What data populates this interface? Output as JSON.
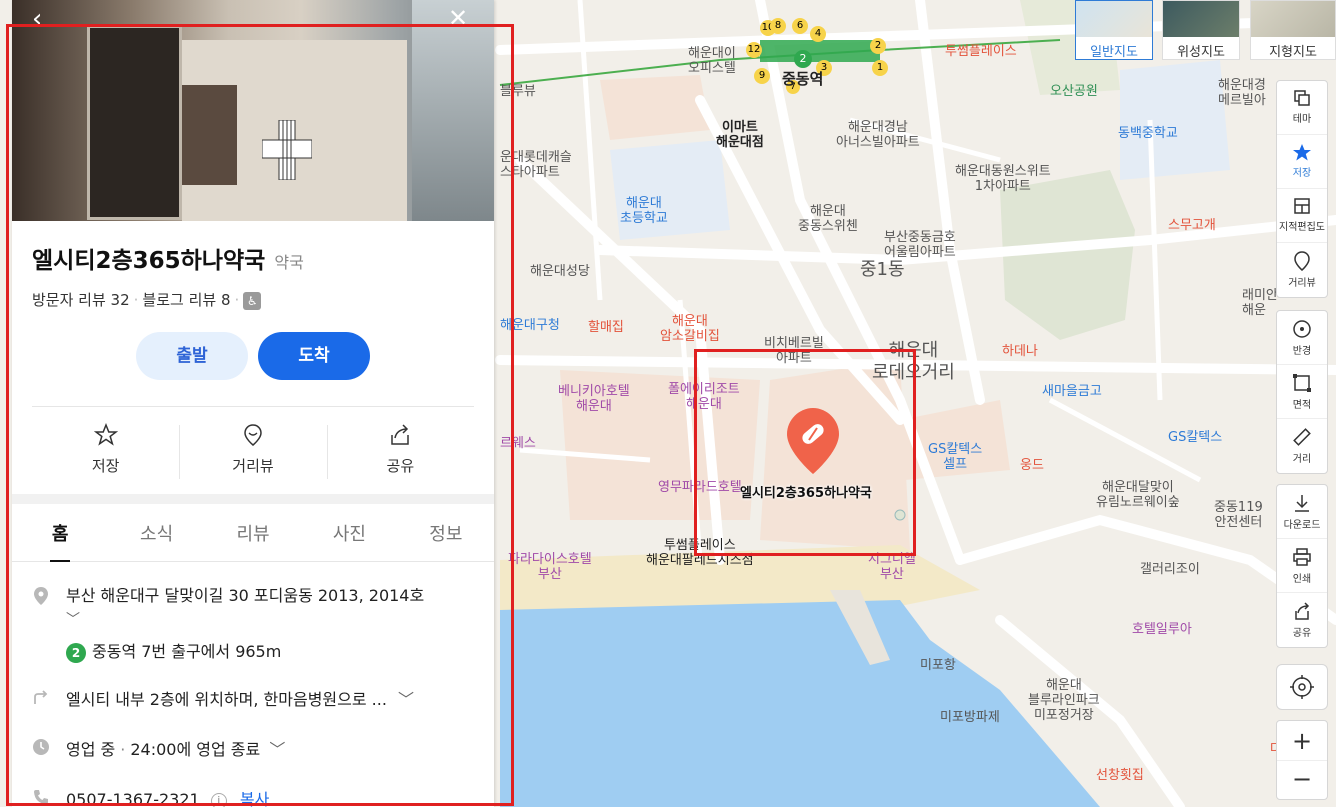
{
  "panel": {
    "title": "엘시티2층365하나약국",
    "category": "약국",
    "visitor_reviews": "방문자 리뷰 32",
    "blog_reviews": "블로그 리뷰 8",
    "buttons": {
      "depart": "출발",
      "arrive": "도착"
    },
    "actions": [
      {
        "label": "저장",
        "icon": "star-icon"
      },
      {
        "label": "거리뷰",
        "icon": "street-view-icon"
      },
      {
        "label": "공유",
        "icon": "share-icon"
      }
    ],
    "tabs": [
      "홈",
      "소식",
      "리뷰",
      "사진",
      "정보"
    ],
    "active_tab": "홈",
    "address": "부산 해운대구 달맞이길 30 포디움동 2013, 2014호",
    "subway_line": "2",
    "subway_text": "중동역 7번 출구에서 965m",
    "directions": "엘시티 내부 2층에 위치하며, 한마음병원으로 ...",
    "hours_status": "영업 중",
    "hours_text": "24:00에 영업 종료",
    "phone": "0507-1367-2321",
    "copy": "복사"
  },
  "map": {
    "marker_label": "엘시티2층365하나약국",
    "map_types": [
      "일반지도",
      "위성지도",
      "지형지도"
    ],
    "active_map_type": "일반지도",
    "labels": [
      {
        "t": "투썸플레이스",
        "c": "poi-red"
      },
      {
        "t": "해운대이\n오피스텔",
        "c": ""
      },
      {
        "t": "중동역",
        "c": "bold"
      },
      {
        "t": "이마트\n해운대점",
        "c": "bold"
      },
      {
        "t": "해운대경남\n아너스빌아파트",
        "c": ""
      },
      {
        "t": "오산공원",
        "c": "poi-green"
      },
      {
        "t": "동백중학교",
        "c": "poi-blue"
      },
      {
        "t": "해운대경\n메르빌아",
        "c": ""
      },
      {
        "t": "해운대동원스위트\n1차아파트",
        "c": ""
      },
      {
        "t": "운대롯데캐슬\n스타아파트",
        "c": ""
      },
      {
        "t": "해운대\n초등학교",
        "c": "poi-blue"
      },
      {
        "t": "해운대\n중동스위첸",
        "c": ""
      },
      {
        "t": "부산중동금호\n어울림아파트",
        "c": ""
      },
      {
        "t": "스무고개",
        "c": "poi-red"
      },
      {
        "t": "중1동",
        "c": "big"
      },
      {
        "t": "해운대성당",
        "c": ""
      },
      {
        "t": "래미안\n해운",
        "c": ""
      },
      {
        "t": "해운대구청",
        "c": "poi-blue"
      },
      {
        "t": "할매집",
        "c": "poi-red"
      },
      {
        "t": "해운대\n암소갈비집",
        "c": "poi-red"
      },
      {
        "t": "비치베르빌\n아파트",
        "c": ""
      },
      {
        "t": "해운대\n로데오거리",
        "c": "big"
      },
      {
        "t": "하데나",
        "c": "poi-red"
      },
      {
        "t": "새마을금고",
        "c": "poi-blue"
      },
      {
        "t": "베니키아호텔\n해운대",
        "c": "poi-purple"
      },
      {
        "t": "폴에이리조트\n해운대",
        "c": "poi-purple"
      },
      {
        "t": "GS칼텍스\n셀프",
        "c": "poi-blue"
      },
      {
        "t": "GS칼텍스",
        "c": "poi-blue"
      },
      {
        "t": "웅드",
        "c": "poi-red"
      },
      {
        "t": "해운대달맞이\n유림노르웨이숲",
        "c": ""
      },
      {
        "t": "중동119\n안전센터",
        "c": ""
      },
      {
        "t": "영무파라드호텔",
        "c": "poi-purple"
      },
      {
        "t": "투썸플레이스\n해운대팔레드시즈점",
        "c": "bold"
      },
      {
        "t": "시그니엘\n부산",
        "c": "poi-purple"
      },
      {
        "t": "파라다이스호텔\n부산",
        "c": "poi-purple"
      },
      {
        "t": "갤러리조이",
        "c": ""
      },
      {
        "t": "호텔일루아",
        "c": "poi-purple"
      },
      {
        "t": "미포항",
        "c": ""
      },
      {
        "t": "해운대\n블루라인파크\n미포정거장",
        "c": ""
      },
      {
        "t": "미포방파제",
        "c": ""
      },
      {
        "t": "선창횟집",
        "c": "poi-red"
      },
      {
        "t": "블루뷰",
        "c": ""
      },
      {
        "t": "르웨스",
        "c": "poi-purple"
      },
      {
        "t": "다",
        "c": "poi-red"
      }
    ],
    "station_exits": [
      "10",
      "8",
      "6",
      "4",
      "12",
      "2",
      "2",
      "3",
      "9",
      "7",
      "1"
    ]
  },
  "toolbar": [
    {
      "label": "테마",
      "icon": "theme-icon"
    },
    {
      "label": "저장",
      "icon": "star-icon"
    },
    {
      "label": "지적편집도",
      "icon": "cadastral-icon"
    },
    {
      "label": "거리뷰",
      "icon": "street-view-icon"
    },
    {
      "label": "반경",
      "icon": "radius-icon"
    },
    {
      "label": "면적",
      "icon": "area-icon"
    },
    {
      "label": "거리",
      "icon": "ruler-icon"
    },
    {
      "label": "다운로드",
      "icon": "download-icon"
    },
    {
      "label": "인쇄",
      "icon": "print-icon"
    },
    {
      "label": "공유",
      "icon": "share-icon"
    }
  ],
  "colors": {
    "accent": "#1a6ae8",
    "highlight": "#e02020",
    "marker": "#f0634a",
    "water": "#9fcdf2",
    "subway": "#2fa84f"
  }
}
